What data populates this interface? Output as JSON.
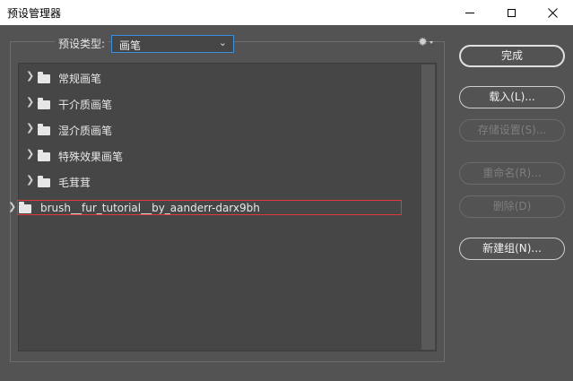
{
  "window": {
    "title": "预设管理器"
  },
  "toolbar": {
    "type_label": "预设类型:",
    "type_value": "画笔",
    "chevron": "⌄",
    "gear_icon": "gear-icon"
  },
  "list": {
    "items": [
      {
        "label": "常规画笔"
      },
      {
        "label": "干介质画笔"
      },
      {
        "label": "湿介质画笔"
      },
      {
        "label": "特殊效果画笔"
      },
      {
        "label": "毛茸茸"
      },
      {
        "label": "brush__fur_tutorial__by_aanderr-darx9bh"
      }
    ]
  },
  "buttons": {
    "done": "完成",
    "load": "载入(L)...",
    "save": "存储设置(S)...",
    "rename": "重命名(R)...",
    "delete": "删除(D)",
    "new_group": "新建组(N)..."
  },
  "colors": {
    "background": "#535353",
    "list_bg": "#464646",
    "selection_outline": "#e0383c",
    "select_focus": "#3c8fe0"
  }
}
